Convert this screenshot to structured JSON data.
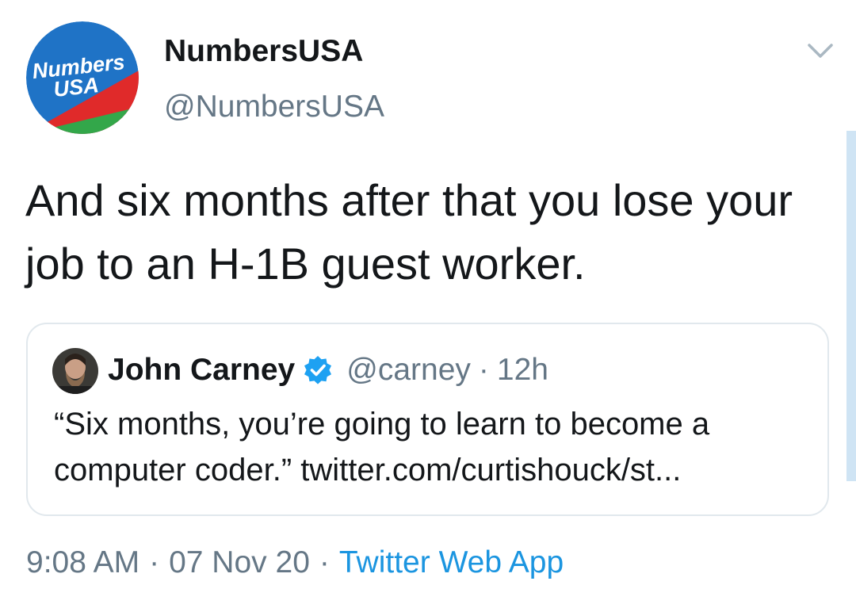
{
  "author": {
    "display_name": "NumbersUSA",
    "handle": "@NumbersUSA",
    "avatar": {
      "logo_text_line1": "Numbers",
      "logo_text_line2": "USA",
      "colors": {
        "blue": "#1f73c6",
        "red": "#e02a2a",
        "green": "#33a74a",
        "text": "#ffffff"
      }
    }
  },
  "tweet": {
    "text": "And six months after that you lose your job to an H-1B guest worker."
  },
  "quoted_tweet": {
    "author_name": "John Carney",
    "verified": true,
    "handle": "@carney",
    "separator": "·",
    "time": "12h",
    "text": "“Six months, you’re going to learn to become a computer coder.” twitter.com/curtishouck/st..."
  },
  "footer": {
    "time": "9:08 AM",
    "separator_1": "·",
    "date": "07 Nov 20",
    "separator_2": "·",
    "source": "Twitter Web App"
  },
  "icons": {
    "caret": "chevron-down-icon",
    "verified": "verified-badge-icon"
  },
  "colors": {
    "text_primary": "#14171a",
    "text_secondary": "#657786",
    "link": "#1b95e0",
    "verified_blue": "#1da1f2",
    "border": "#e1e8ed"
  }
}
